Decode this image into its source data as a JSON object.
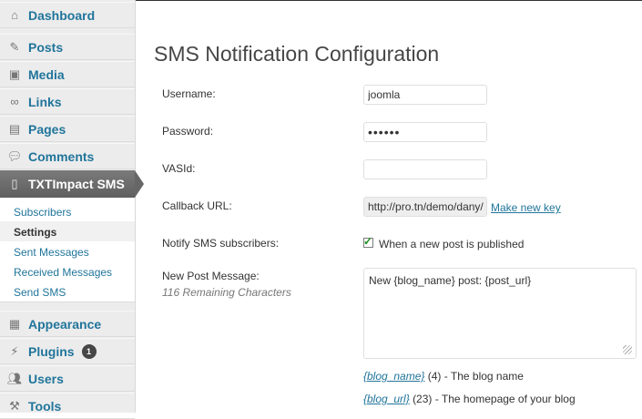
{
  "sidebar": {
    "dashboard": "Dashboard",
    "posts": "Posts",
    "media": "Media",
    "links": "Links",
    "pages": "Pages",
    "comments": "Comments",
    "plugin": "TXTImpact SMS",
    "submenu": [
      "Subscribers",
      "Settings",
      "Sent Messages",
      "Received Messages",
      "Send SMS"
    ],
    "appearance": "Appearance",
    "plugins": "Plugins",
    "plugins_badge": "1",
    "users": "Users",
    "tools": "Tools"
  },
  "page": {
    "title": "SMS Notification Configuration"
  },
  "form": {
    "username_label": "Username:",
    "username_value": "joomla",
    "password_label": "Password:",
    "password_value": "••••••",
    "vasid_label": "VASId:",
    "vasid_value": "",
    "callback_label": "Callback URL:",
    "callback_value": "http://pro.tn/demo/dany/",
    "make_key_link": "Make new key",
    "notify_label": "Notify SMS subscribers:",
    "notify_checkbox_label": "When a new post is published",
    "notify_checked": true,
    "newpost_label": "New Post Message:",
    "remaining": "116 Remaining Characters",
    "message_value": "New {blog_name} post: {post_url}"
  },
  "tags": [
    {
      "token": "{blog_name}",
      "count": "(4)",
      "desc": "- The blog name"
    },
    {
      "token": "{blog_url}",
      "count": "(23)",
      "desc": "- The homepage of your blog"
    }
  ],
  "colors": {
    "link": "#21759b",
    "active_menu": "#6d6d6d"
  }
}
